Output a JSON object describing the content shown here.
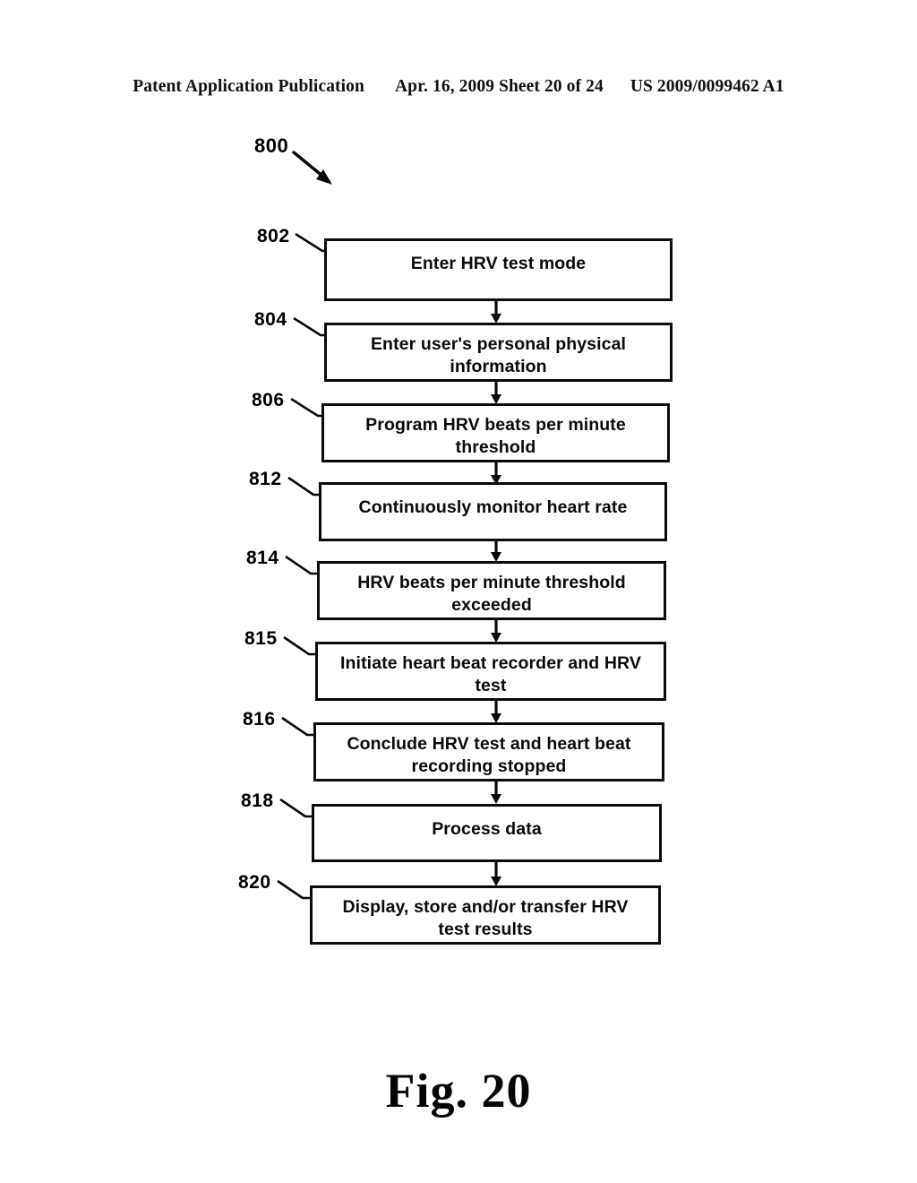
{
  "page": {
    "header": {
      "publication": "Patent Application Publication",
      "date_sheet": "Apr. 16, 2009  Sheet 20 of 24",
      "publication_number": "US 2009/0099462 A1"
    },
    "caption": "Fig. 20",
    "figure_reference": "800"
  },
  "flowchart": {
    "title_reference": "800",
    "steps": [
      {
        "ref": "802",
        "text": "Enter HRV test mode",
        "lines": 1
      },
      {
        "ref": "804",
        "text": "Enter user's personal physical\ninformation",
        "lines": 2
      },
      {
        "ref": "806",
        "text": "Program HRV beats per minute\nthreshold",
        "lines": 2
      },
      {
        "ref": "812",
        "text": "Continuously monitor heart rate",
        "lines": 1
      },
      {
        "ref": "814",
        "text": "HRV beats per minute threshold\nexceeded",
        "lines": 2
      },
      {
        "ref": "815",
        "text": "Initiate heart beat recorder and HRV\ntest",
        "lines": 2
      },
      {
        "ref": "816",
        "text": "Conclude HRV test and heart beat\nrecording stopped",
        "lines": 2
      },
      {
        "ref": "818",
        "text": "Process data",
        "lines": 1
      },
      {
        "ref": "820",
        "text": "Display, store and/or transfer HRV\ntest results",
        "lines": 2
      }
    ]
  },
  "colors": {
    "ink": "#0a0a0a",
    "paper": "#ffffff"
  }
}
